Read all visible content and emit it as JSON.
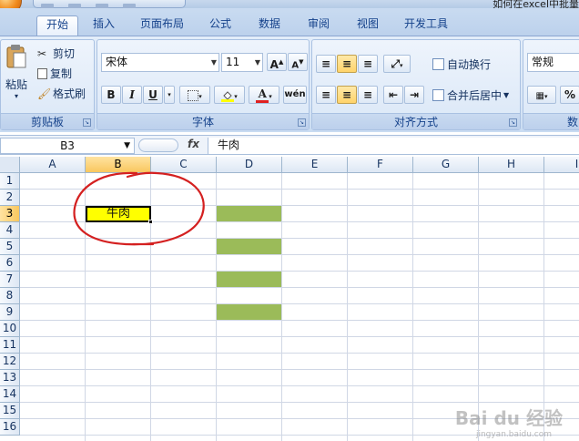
{
  "window": {
    "title": "如何在excel中批量"
  },
  "tabs": [
    "开始",
    "插入",
    "页面布局",
    "公式",
    "数据",
    "审阅",
    "视图",
    "开发工具"
  ],
  "active_tab": "开始",
  "clipboard": {
    "paste": "粘贴",
    "cut": "剪切",
    "copy": "复制",
    "format_painter": "格式刷",
    "group_title": "剪贴板"
  },
  "font": {
    "name": "宋体",
    "size": "11",
    "grow": "A",
    "shrink": "A",
    "bold": "B",
    "italic": "I",
    "underline": "U",
    "group_title": "字体",
    "highlight_color": "#ffff00",
    "font_color": "#e02020",
    "phonetic": "wén"
  },
  "alignment": {
    "wrap_text": "自动换行",
    "merge_center": "合并后居中",
    "group_title": "对齐方式"
  },
  "number": {
    "format": "常规",
    "percent": "%",
    "group_title": "数"
  },
  "formula_bar": {
    "name_box": "B3",
    "fx": "fx",
    "content": "牛肉"
  },
  "sheet": {
    "columns": [
      "A",
      "B",
      "C",
      "D",
      "E",
      "F",
      "G",
      "H",
      "I"
    ],
    "rows": [
      "1",
      "2",
      "3",
      "4",
      "5",
      "6",
      "7",
      "8",
      "9",
      "10",
      "11",
      "12",
      "13",
      "14",
      "15",
      "16"
    ],
    "selected_cell": {
      "column": "B",
      "row": 3,
      "value": "牛肉"
    },
    "filled_cells": [
      {
        "column": "B",
        "row": 3,
        "color": "#ffff00"
      },
      {
        "column": "D",
        "row": 3,
        "color": "#9bbb59"
      },
      {
        "column": "D",
        "row": 5,
        "color": "#9bbb59"
      },
      {
        "column": "D",
        "row": 7,
        "color": "#9bbb59"
      },
      {
        "column": "D",
        "row": 9,
        "color": "#9bbb59"
      }
    ],
    "annotation_color": "#d42020"
  },
  "watermark": {
    "logo": "Bai du 经验",
    "url": "jingyan.baidu.com"
  }
}
